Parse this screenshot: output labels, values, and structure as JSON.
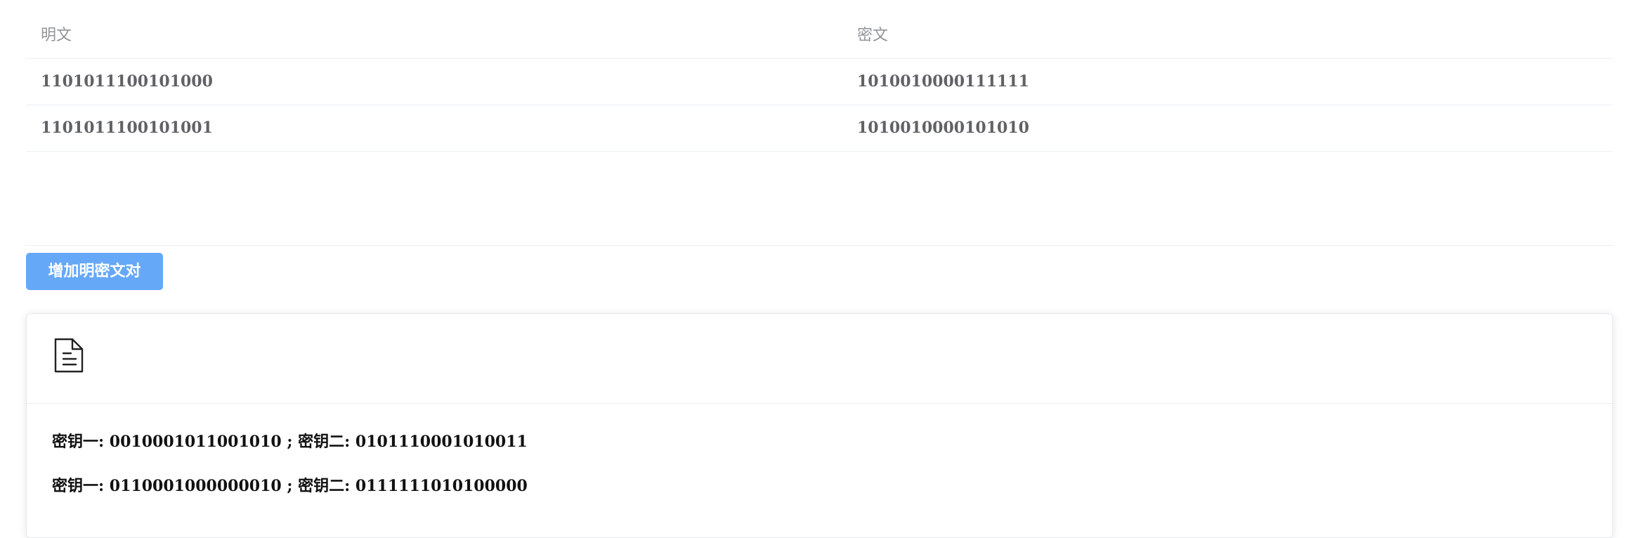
{
  "table": {
    "headers": [
      "明文",
      "密文"
    ],
    "rows": [
      [
        "1101011100101000",
        "1010010000111111"
      ],
      [
        "1101011100101001",
        "1010010000101010"
      ]
    ]
  },
  "actions": {
    "add_pair_label": "增加明密文对"
  },
  "result": {
    "icon": "document-icon",
    "lines": [
      "密钥一: 0010001011001010 ; 密钥二: 0101110001010011",
      "密钥一: 0110001000000010 ; 密钥二: 0111111010100000"
    ]
  },
  "colors": {
    "primary_button": "#66a8f8",
    "header_text": "#909399",
    "cell_text": "#606266",
    "border": "#ebeef5"
  }
}
